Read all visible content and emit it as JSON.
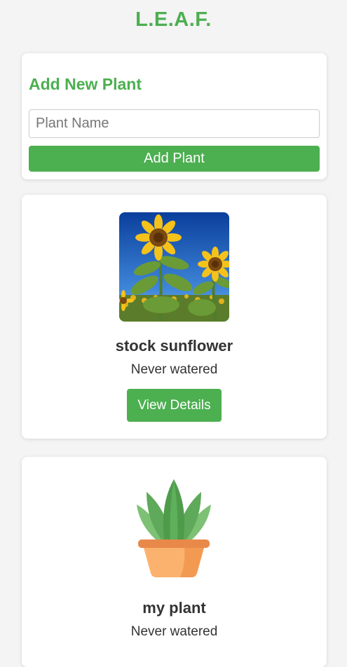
{
  "app": {
    "title": "L.E.A.F."
  },
  "add_form": {
    "heading": "Add New Plant",
    "input_placeholder": "Plant Name",
    "input_value": "",
    "submit_label": "Add Plant"
  },
  "plants": [
    {
      "name": "stock sunflower",
      "status": "Never watered",
      "details_label": "View Details",
      "image": "sunflower-photo"
    },
    {
      "name": "my plant",
      "status": "Never watered",
      "image": "potted-plant-icon"
    }
  ],
  "colors": {
    "accent": "#4caf50",
    "background": "#f4f4f4",
    "card": "#ffffff",
    "text": "#333333"
  }
}
